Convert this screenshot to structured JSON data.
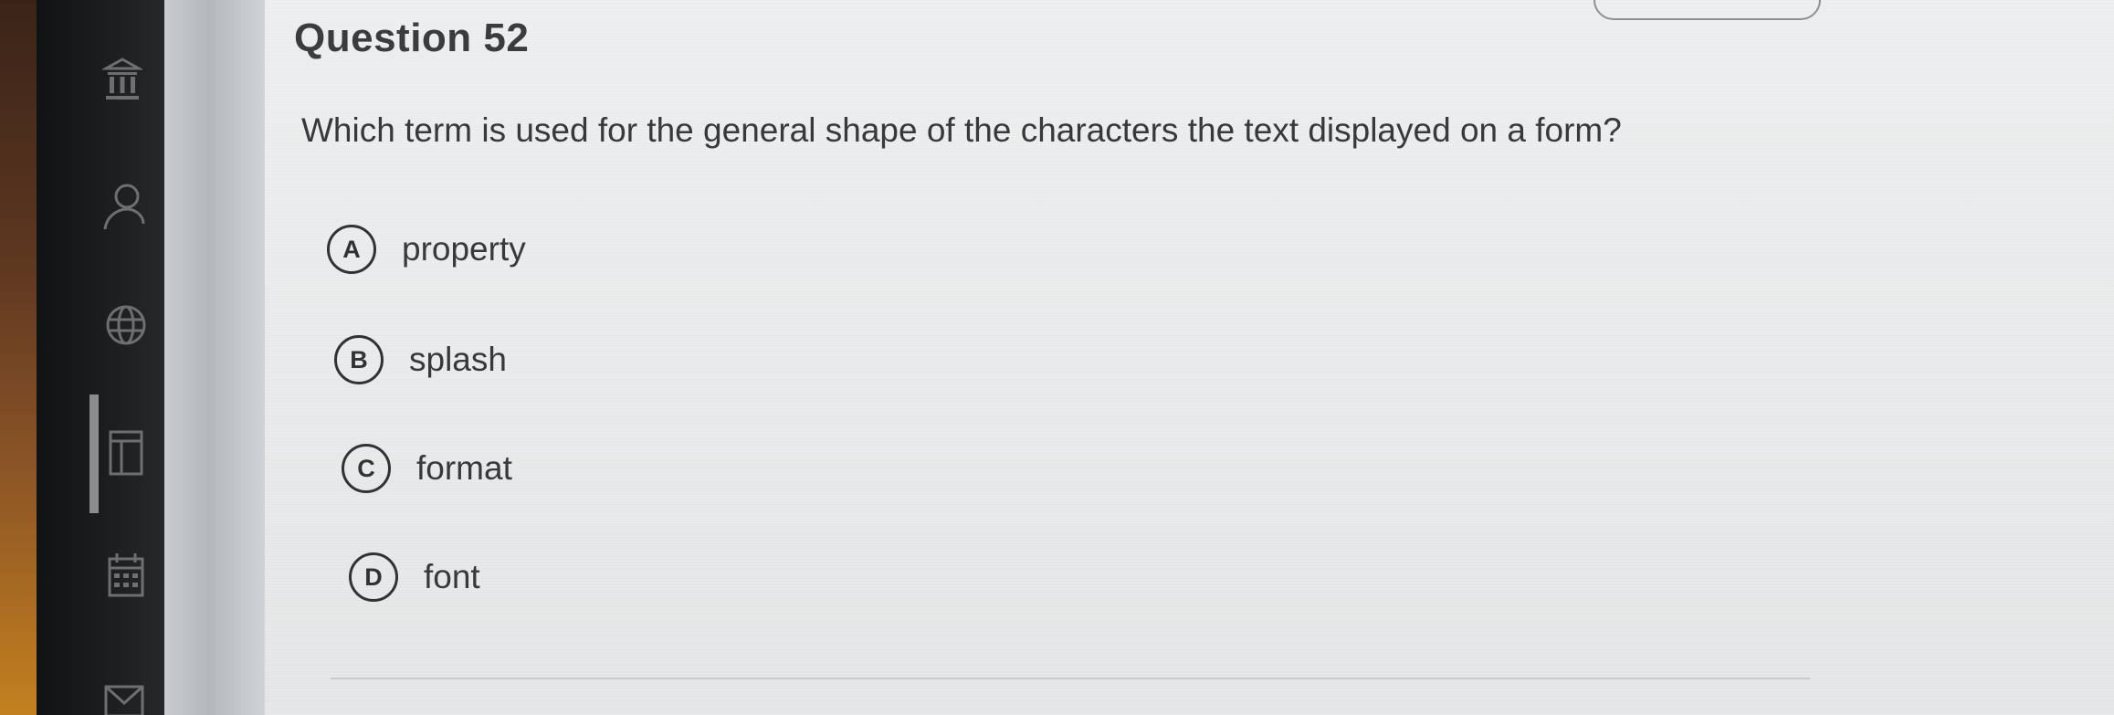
{
  "question": {
    "title": "Question 52",
    "text": "Which term is used for the general shape of the characters the text displayed on a form?",
    "options": [
      {
        "letter": "A",
        "label": "property"
      },
      {
        "letter": "B",
        "label": "splash"
      },
      {
        "letter": "C",
        "label": "format"
      },
      {
        "letter": "D",
        "label": "font"
      }
    ]
  },
  "sidebar": {
    "icons": [
      "institution-icon",
      "user-icon",
      "globe-icon",
      "document-icon",
      "calendar-icon",
      "mail-icon"
    ]
  },
  "colors": {
    "sidebar": "#1d1e20",
    "content_bg": "#e8eaeb",
    "text": "#37393c"
  }
}
